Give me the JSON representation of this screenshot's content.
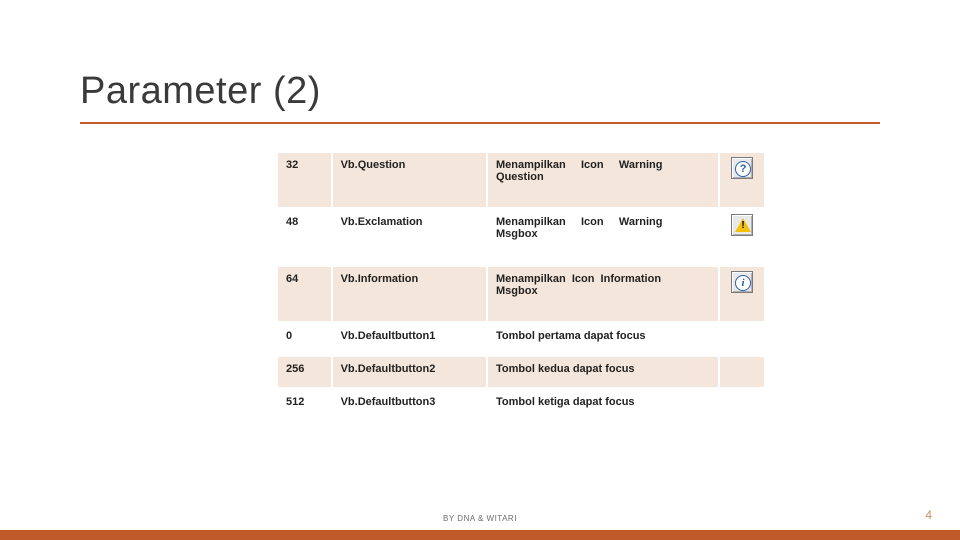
{
  "title": "Parameter (2)",
  "footer": "BY DNA & WITARI",
  "page_number": "4",
  "accent_color": "#c05a2a",
  "rows": [
    {
      "code": "32",
      "const": "Vb.Question",
      "desc": "Menampilkan     Icon     Warning\nQuestion",
      "icon": "question",
      "tall": true
    },
    {
      "code": "48",
      "const": "Vb.Exclamation",
      "desc": "Menampilkan     Icon     Warning\nMsgbox",
      "icon": "exclamation",
      "tall": true
    },
    {
      "code": "64",
      "const": "Vb.Information",
      "desc": "Menampilkan  Icon  Information\nMsgbox",
      "icon": "information",
      "tall": true
    },
    {
      "code": "0",
      "const": "Vb.Defaultbutton1",
      "desc": "Tombol pertama dapat focus",
      "icon": "",
      "tall": false
    },
    {
      "code": "256",
      "const": "Vb.Defaultbutton2",
      "desc": "Tombol kedua dapat focus",
      "icon": "",
      "tall": false
    },
    {
      "code": "512",
      "const": "Vb.Defaultbutton3",
      "desc": "Tombol ketiga dapat focus",
      "icon": "",
      "tall": false
    }
  ]
}
